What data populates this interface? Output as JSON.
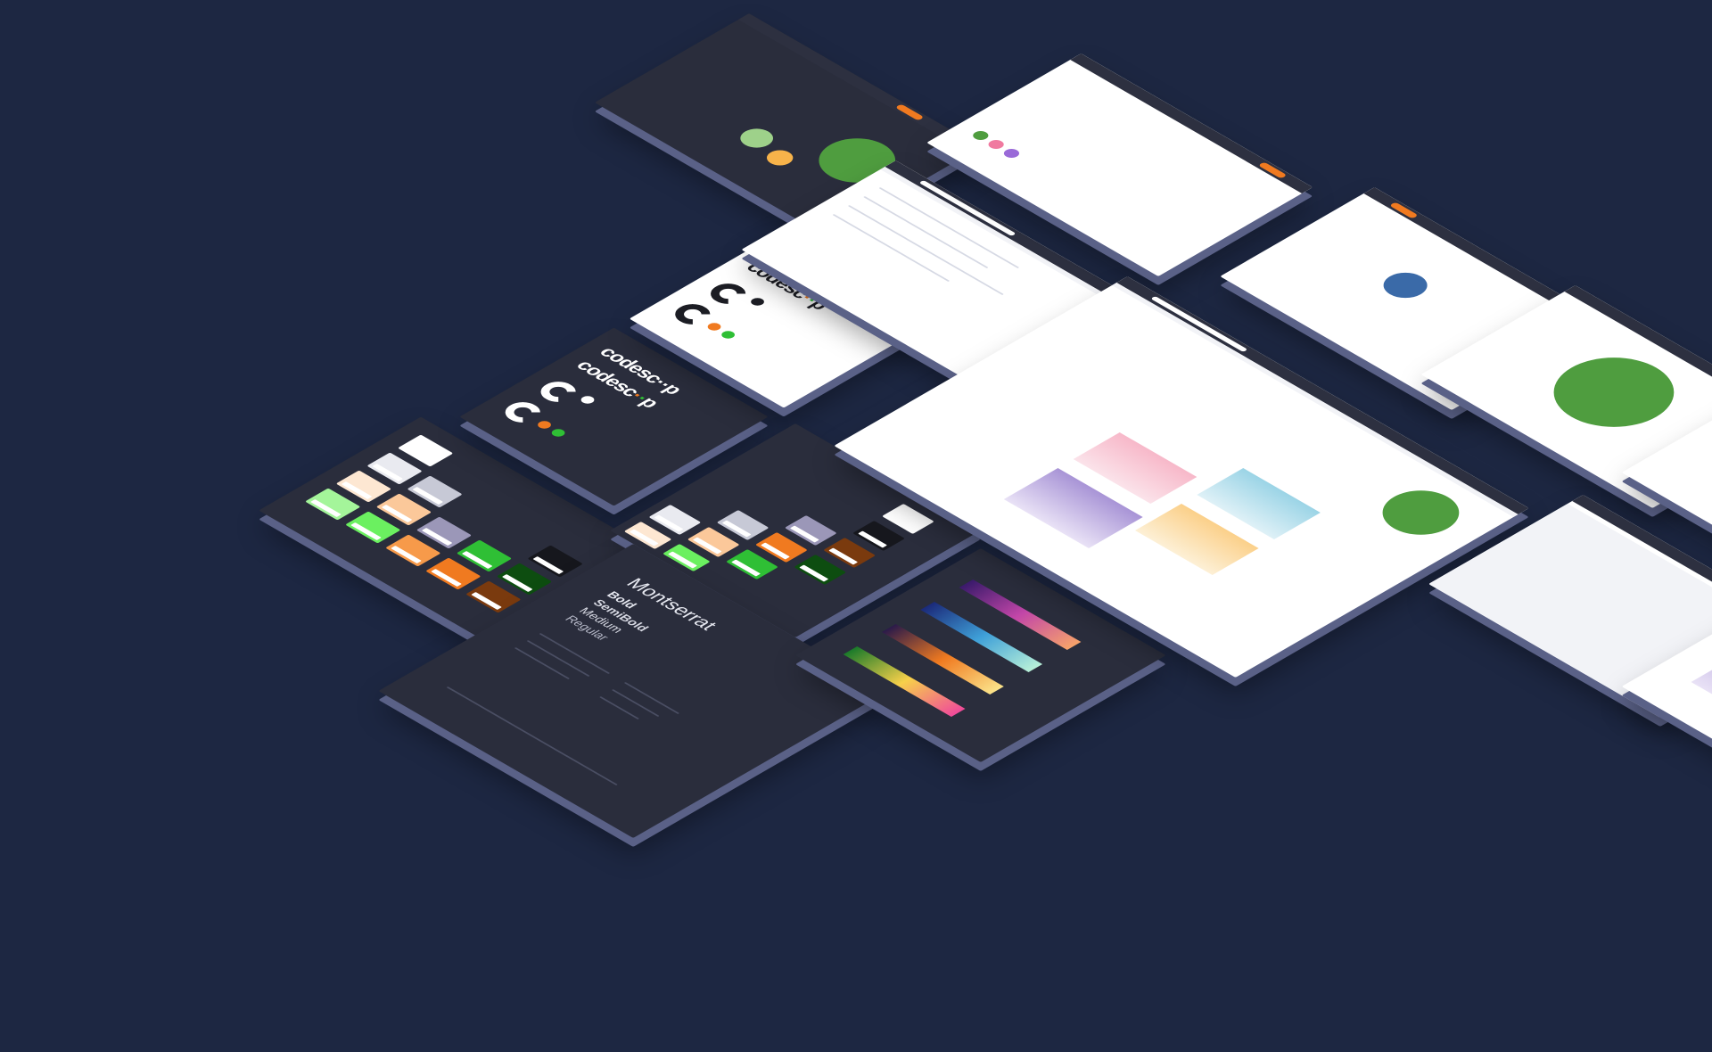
{
  "brand": {
    "wordmark": "codesc",
    "wordmark_suffix": "p",
    "colors": {
      "background": "#1d2742",
      "card_dark": "#2a2d3c",
      "card_edge": "#5a6187",
      "accent_orange": "#f07a20",
      "accent_green": "#2fbf35",
      "bubble_green": "#4f9d3f"
    }
  },
  "typography": {
    "font_name": "Montserrat",
    "weights": [
      "Bold",
      "SemiBold",
      "Medium",
      "Regular"
    ]
  },
  "gradient_palettes": [
    "purple-orange",
    "blue-teal",
    "orange-yellow",
    "green-pink"
  ]
}
